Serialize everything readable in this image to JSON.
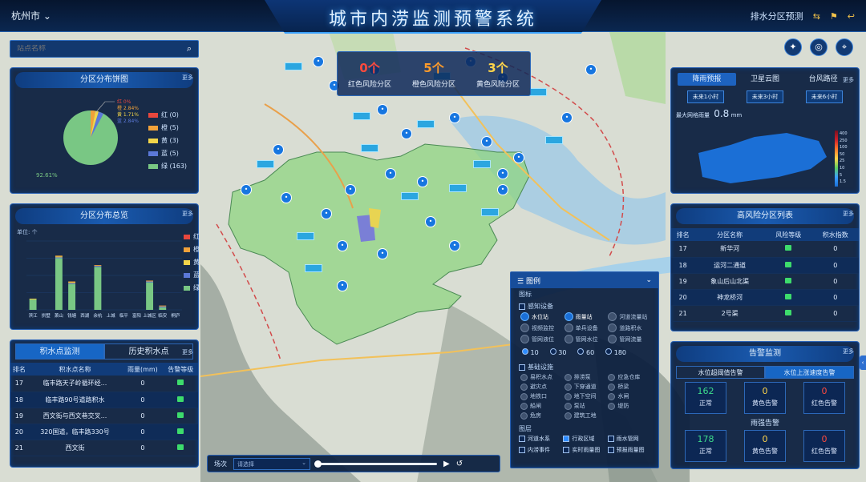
{
  "header": {
    "city": "杭州市",
    "title": "城市内涝监测预警系统",
    "right_label": "排水分区预测"
  },
  "search": {
    "placeholder": "站点名称"
  },
  "banner": [
    {
      "count": "0个",
      "label": "红色风险分区",
      "color": "#ff4a3d"
    },
    {
      "count": "5个",
      "label": "橙色风险分区",
      "color": "#ff9b2a"
    },
    {
      "count": "3个",
      "label": "黄色风险分区",
      "color": "#ffd54a"
    }
  ],
  "pie_panel": {
    "title": "分区分布饼图",
    "more": "更多",
    "slice_labels": [
      "红 0%",
      "橙 2.84%",
      "黄 1.71%",
      "蓝 2.84%",
      "92.61%"
    ],
    "legend": [
      {
        "name": "红 (0)",
        "color": "#e8473d"
      },
      {
        "name": "橙 (5)",
        "color": "#f0a13a"
      },
      {
        "name": "黄 (3)",
        "color": "#f2d54a"
      },
      {
        "name": "蓝 (5)",
        "color": "#5b78d8"
      },
      {
        "name": "绿 (163)",
        "color": "#79c784"
      }
    ]
  },
  "bar_panel": {
    "title": "分区分布总览",
    "more": "更多",
    "unit": "单位: 个",
    "legend": [
      {
        "name": "红",
        "color": "#e8473d"
      },
      {
        "name": "橙",
        "color": "#f0a13a"
      },
      {
        "name": "黄",
        "color": "#f2d54a"
      },
      {
        "name": "蓝",
        "color": "#5b78d8"
      },
      {
        "name": "绿",
        "color": "#79c784"
      }
    ]
  },
  "chart_data": {
    "type": "bar",
    "title": "分区分布总览",
    "ylabel": "单位: 个",
    "categories": [
      "滨江",
      "拱墅",
      "萧山",
      "钱塘",
      "西湖",
      "余杭",
      "上城",
      "临平",
      "富阳",
      "上城区",
      "临安",
      "桐庐"
    ],
    "series": [
      {
        "name": "绿",
        "values": [
          12,
          0,
          60,
          30,
          0,
          50,
          0,
          0,
          0,
          32,
          3,
          0
        ]
      },
      {
        "name": "蓝",
        "values": [
          0,
          0,
          1,
          1,
          0,
          1,
          0,
          0,
          0,
          1,
          1,
          0
        ]
      },
      {
        "name": "黄",
        "values": [
          1,
          0,
          1,
          1,
          0,
          0,
          0,
          0,
          0,
          0,
          0,
          0
        ]
      },
      {
        "name": "橙",
        "values": [
          0,
          0,
          1,
          1,
          0,
          1,
          0,
          0,
          0,
          1,
          1,
          0
        ]
      },
      {
        "name": "红",
        "values": [
          0,
          0,
          0,
          0,
          0,
          0,
          0,
          0,
          0,
          0,
          0,
          0
        ]
      }
    ],
    "ylim": [
      0,
      80
    ],
    "legend_position": "right"
  },
  "water_panel": {
    "tabs": [
      "积水点监测",
      "历史积水点"
    ],
    "more": "更多",
    "columns": [
      "排名",
      "积水点名称",
      "雨量(mm)",
      "告警等级"
    ],
    "rows": [
      [
        "17",
        "临丰路天子岭循环经...",
        "0"
      ],
      [
        "18",
        "临丰路90号道路积水",
        "0"
      ],
      [
        "19",
        "西文街与西文巷交叉...",
        "0"
      ],
      [
        "20",
        "320国道，临丰路330号",
        "0"
      ],
      [
        "21",
        "西文街",
        "0"
      ]
    ]
  },
  "rain_panel": {
    "tabs": [
      "降雨预报",
      "卫星云图",
      "台风路径"
    ],
    "more": "更多",
    "buttons": [
      "未来1小时",
      "未来3小时",
      "未来6小时"
    ],
    "max_label": "最大网格雨量",
    "max_value": "0.8",
    "max_unit": "mm",
    "scale": [
      "400",
      "250",
      "100",
      "50",
      "25",
      "10",
      "5",
      "1.5"
    ]
  },
  "risk_panel": {
    "title": "高风险分区列表",
    "more": "更多",
    "columns": [
      "排名",
      "分区名称",
      "风险等级",
      "积水指数"
    ],
    "rows": [
      [
        "17",
        "新华河",
        "0"
      ],
      [
        "18",
        "运河二通道",
        "0"
      ],
      [
        "19",
        "象山后山北渠",
        "0"
      ],
      [
        "20",
        "神龙桥河",
        "0"
      ],
      [
        "21",
        "2号渠",
        "0"
      ]
    ]
  },
  "alarm_panel": {
    "title": "告警监测",
    "more": "更多",
    "tabs": [
      "水位超阈值告警",
      "水位上涨速度告警"
    ],
    "water": [
      {
        "value": "162",
        "label": "正常",
        "color": "#3ddc8c"
      },
      {
        "value": "0",
        "label": "黄色告警",
        "color": "#ffd54a"
      },
      {
        "value": "0",
        "label": "红色告警",
        "color": "#ff4a3d"
      }
    ],
    "rain_title": "雨强告警",
    "rain": [
      {
        "value": "178",
        "label": "正常",
        "color": "#3ddc8c"
      },
      {
        "value": "0",
        "label": "黄色告警",
        "color": "#ffd54a"
      },
      {
        "value": "0",
        "label": "红色告警",
        "color": "#ff4a3d"
      }
    ]
  },
  "legend_panel": {
    "title": "图例",
    "section_icons": "图标",
    "sensing": "感知设备",
    "sensing_items": [
      "水位站",
      "雨量站",
      "河道流量站",
      "视频监控",
      "单兵设备",
      "道路积水",
      "管网液位",
      "管网水位",
      "管网流量"
    ],
    "radius": [
      "10",
      "30",
      "60",
      "180"
    ],
    "base": "基础设施",
    "base_items": [
      "易积水点",
      "排涝泵",
      "应急仓库",
      "避灾点",
      "下穿通道",
      "桥梁",
      "地铁口",
      "地下空间",
      "水闸",
      "船闸",
      "泵站",
      "堤防",
      "危房",
      "建筑工地"
    ],
    "section_layers": "图层",
    "layers": [
      {
        "name": "河道水系",
        "on": false
      },
      {
        "name": "行政区域",
        "on": true
      },
      {
        "name": "雨水管网",
        "on": false
      },
      {
        "name": "内涝事件",
        "on": false
      },
      {
        "name": "实时雨量图",
        "on": false
      },
      {
        "name": "预报雨量图",
        "on": false
      }
    ]
  },
  "player": {
    "label": "场次",
    "select_placeholder": "请选择"
  }
}
